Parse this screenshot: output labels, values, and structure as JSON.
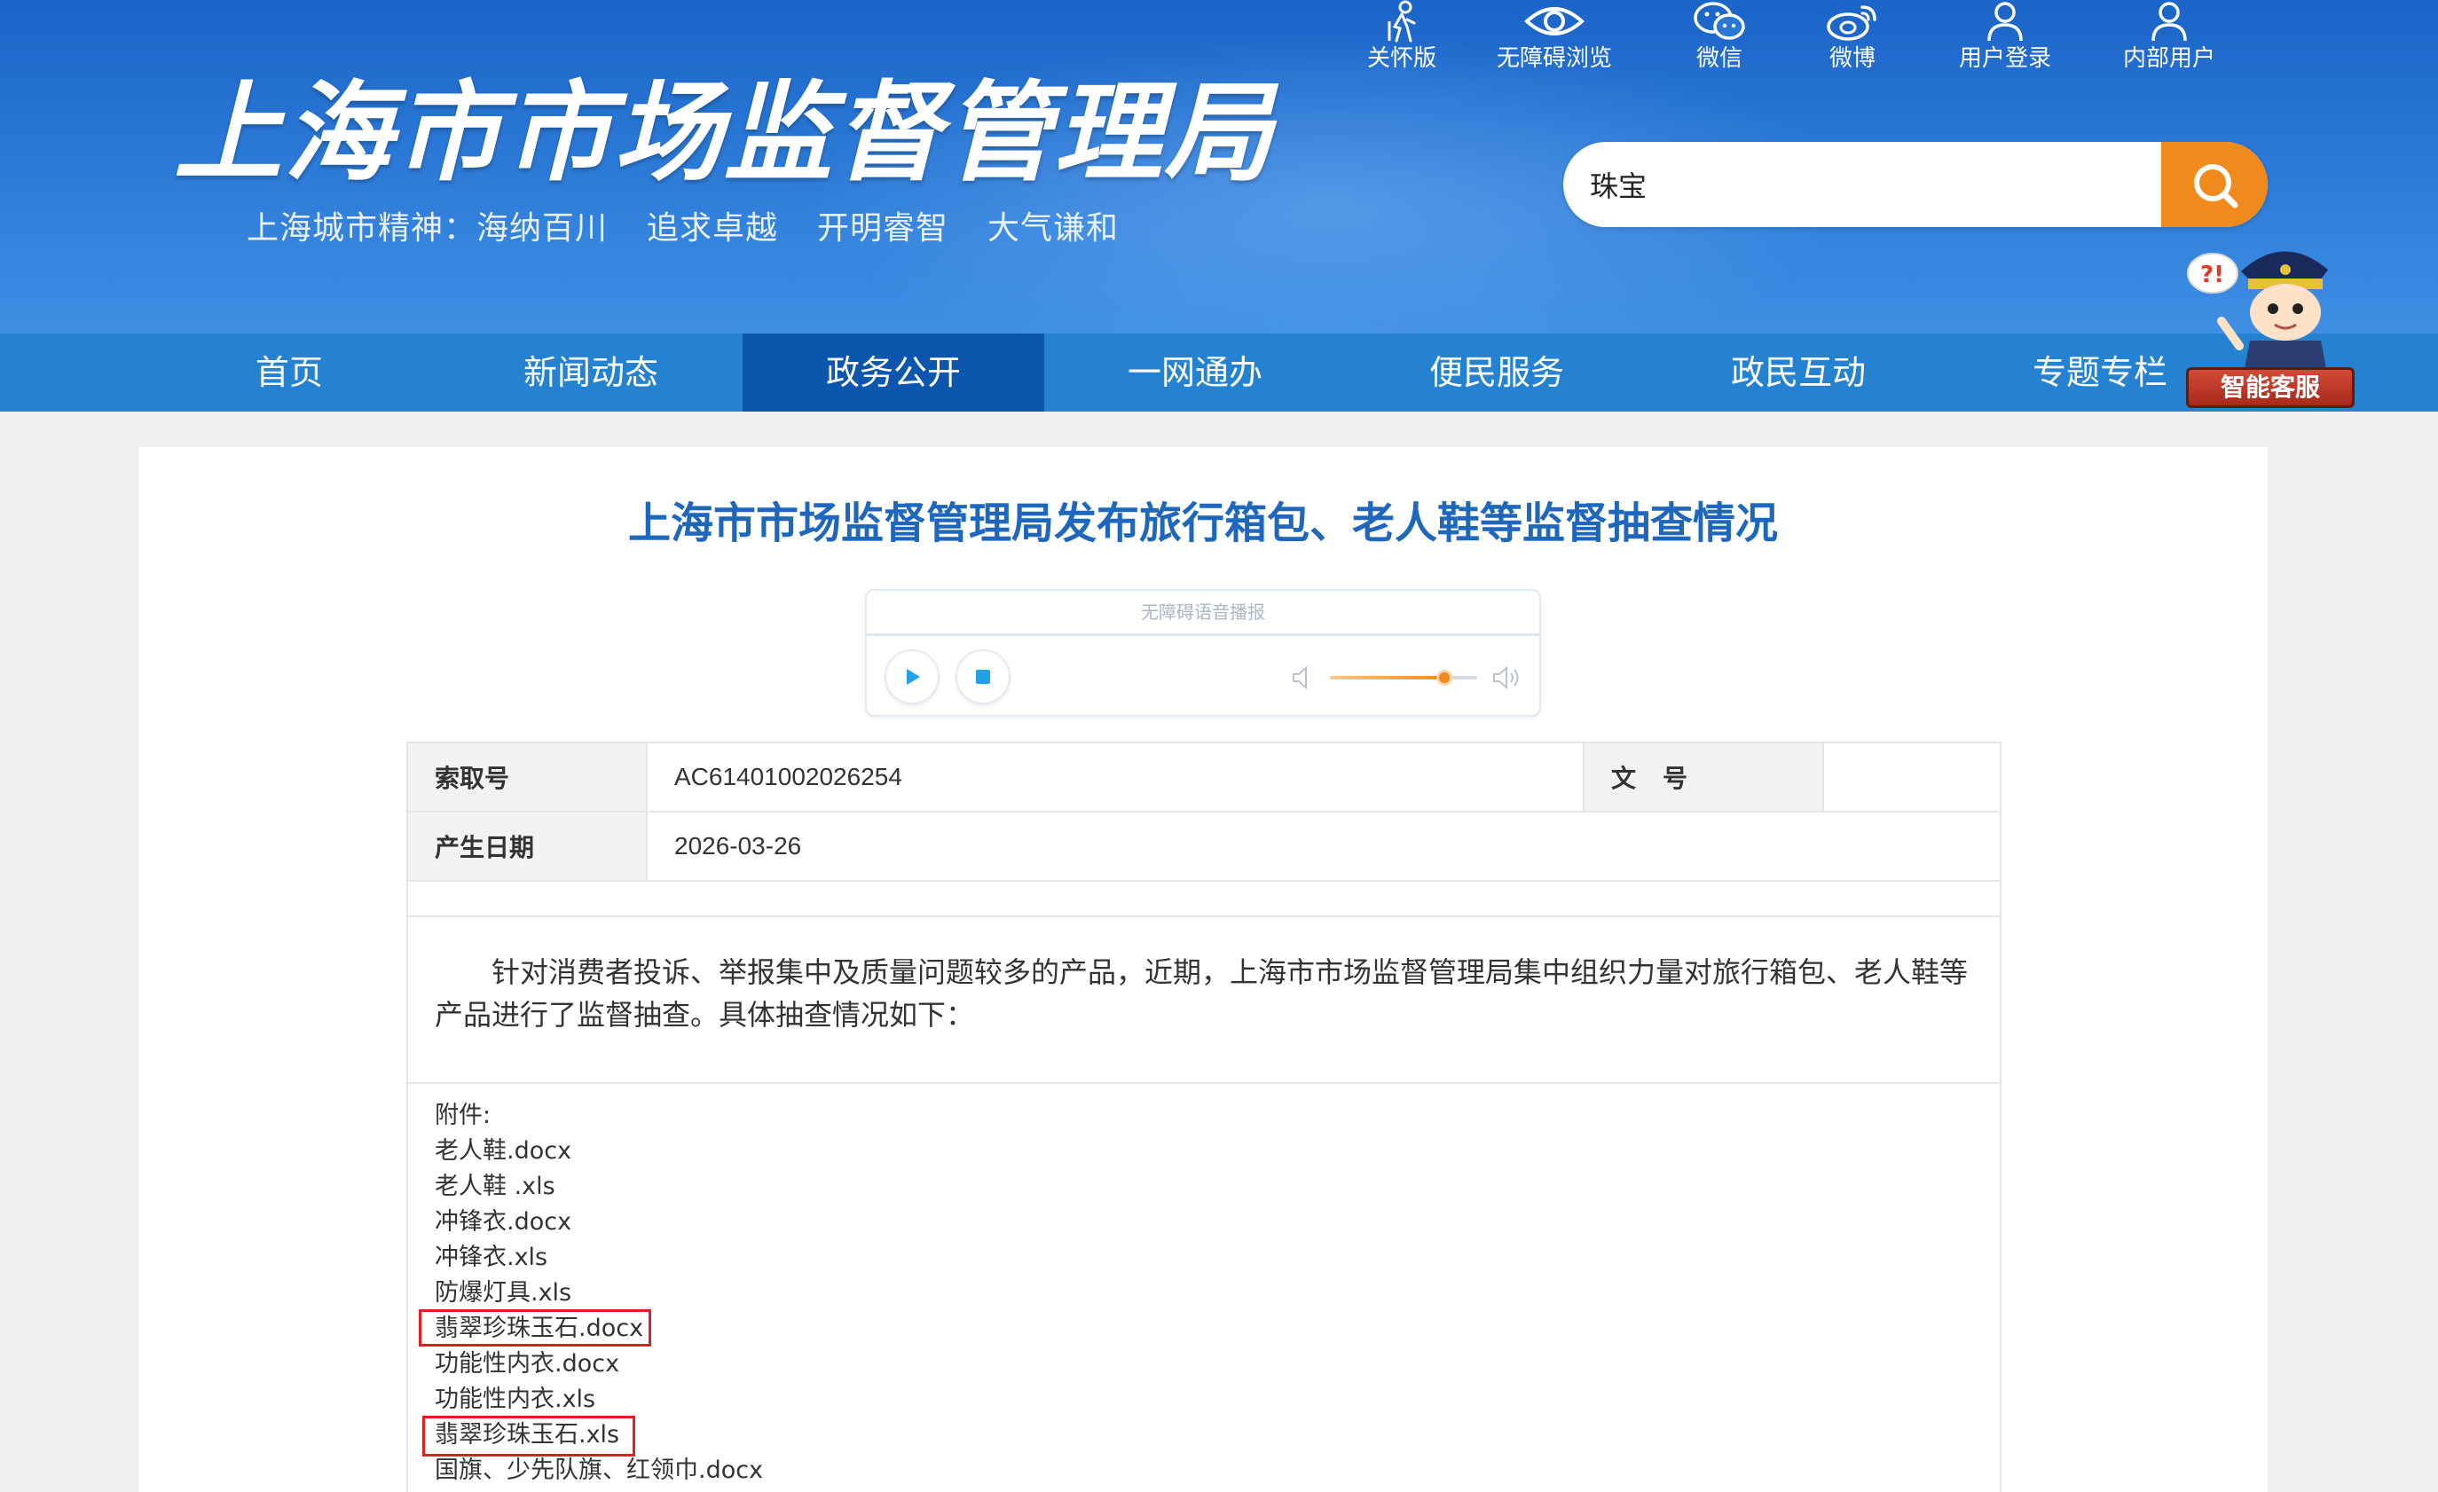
{
  "header": {
    "logo_title": "上海市市场监督管理局",
    "slogan": "上海城市精神：海纳百川    追求卓越    开明睿智    大气谦和",
    "top_links": [
      {
        "label": "关怀版",
        "icon": "elderly-care-icon"
      },
      {
        "label": "无障碍浏览",
        "icon": "eye-icon"
      },
      {
        "label": "微信",
        "icon": "wechat-icon"
      },
      {
        "label": "微博",
        "icon": "weibo-icon"
      },
      {
        "label": "用户登录",
        "icon": "user-icon"
      },
      {
        "label": "内部用户",
        "icon": "user-icon"
      }
    ],
    "search": {
      "value": "珠宝",
      "icon": "search-icon"
    }
  },
  "nav": {
    "items": [
      "首页",
      "新闻动态",
      "政务公开",
      "一网通办",
      "便民服务",
      "政民互动",
      "专题专栏"
    ],
    "active": "政务公开"
  },
  "service": {
    "label": "智能客服"
  },
  "article": {
    "title": "上海市市场监督管理局发布旅行箱包、老人鞋等监督抽查情况",
    "player": {
      "title": "无障碍语音播报",
      "volume_percent": 78
    },
    "meta": {
      "index_label": "索取号",
      "index_value": "AC61401002026254",
      "docno_label": "文号",
      "date_label": "产生日期",
      "date_value": "2026-03-26"
    },
    "body": "针对消费者投诉、举报集中及质量问题较多的产品，近期，上海市市场监督管理局集中组织力量对旅行箱包、老人鞋等产品进行了监督抽查。具体抽查情况如下：",
    "attachments_label": "附件:",
    "attachments": [
      "老人鞋.docx",
      "老人鞋 .xls",
      "冲锋衣.docx",
      "冲锋衣.xls",
      "防爆灯具.xls",
      "翡翠珍珠玉石.docx",
      "功能性内衣.docx",
      "功能性内衣.xls",
      "翡翠珍珠玉石.xls",
      "国旗、少先队旗、红领巾.docx"
    ]
  },
  "colors": {
    "header_blue": "#2a78d6",
    "nav_blue": "#2582d1",
    "nav_active": "#0c57ad",
    "title_blue": "#1f67bd",
    "search_orange": "#f08a1c",
    "highlight_red": "#e02020"
  }
}
